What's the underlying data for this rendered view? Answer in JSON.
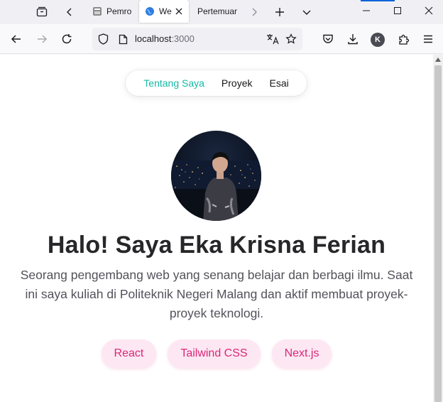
{
  "browser": {
    "tabs": [
      {
        "label": "Pemro",
        "active": false
      },
      {
        "label": "We",
        "active": true
      },
      {
        "label": "Pertemuar",
        "active": false
      }
    ],
    "url": {
      "host": "localhost",
      "port": ":3000"
    },
    "account_initial": "K"
  },
  "site": {
    "nav": [
      {
        "label": "Tentang Saya",
        "current": true
      },
      {
        "label": "Proyek",
        "current": false
      },
      {
        "label": "Esai",
        "current": false
      }
    ],
    "title": "Halo! Saya Eka Krisna Ferian",
    "description": "Seorang pengembang web yang senang belajar dan berbagi ilmu. Saat ini saya kuliah di Politeknik Negeri Malang dan aktif membuat proyek-proyek teknologi.",
    "tags": [
      "React",
      "Tailwind CSS",
      "Next.js"
    ]
  },
  "colors": {
    "accent": "#14b8a6",
    "tag_bg": "#fce7f3",
    "tag_text": "#db2777"
  }
}
